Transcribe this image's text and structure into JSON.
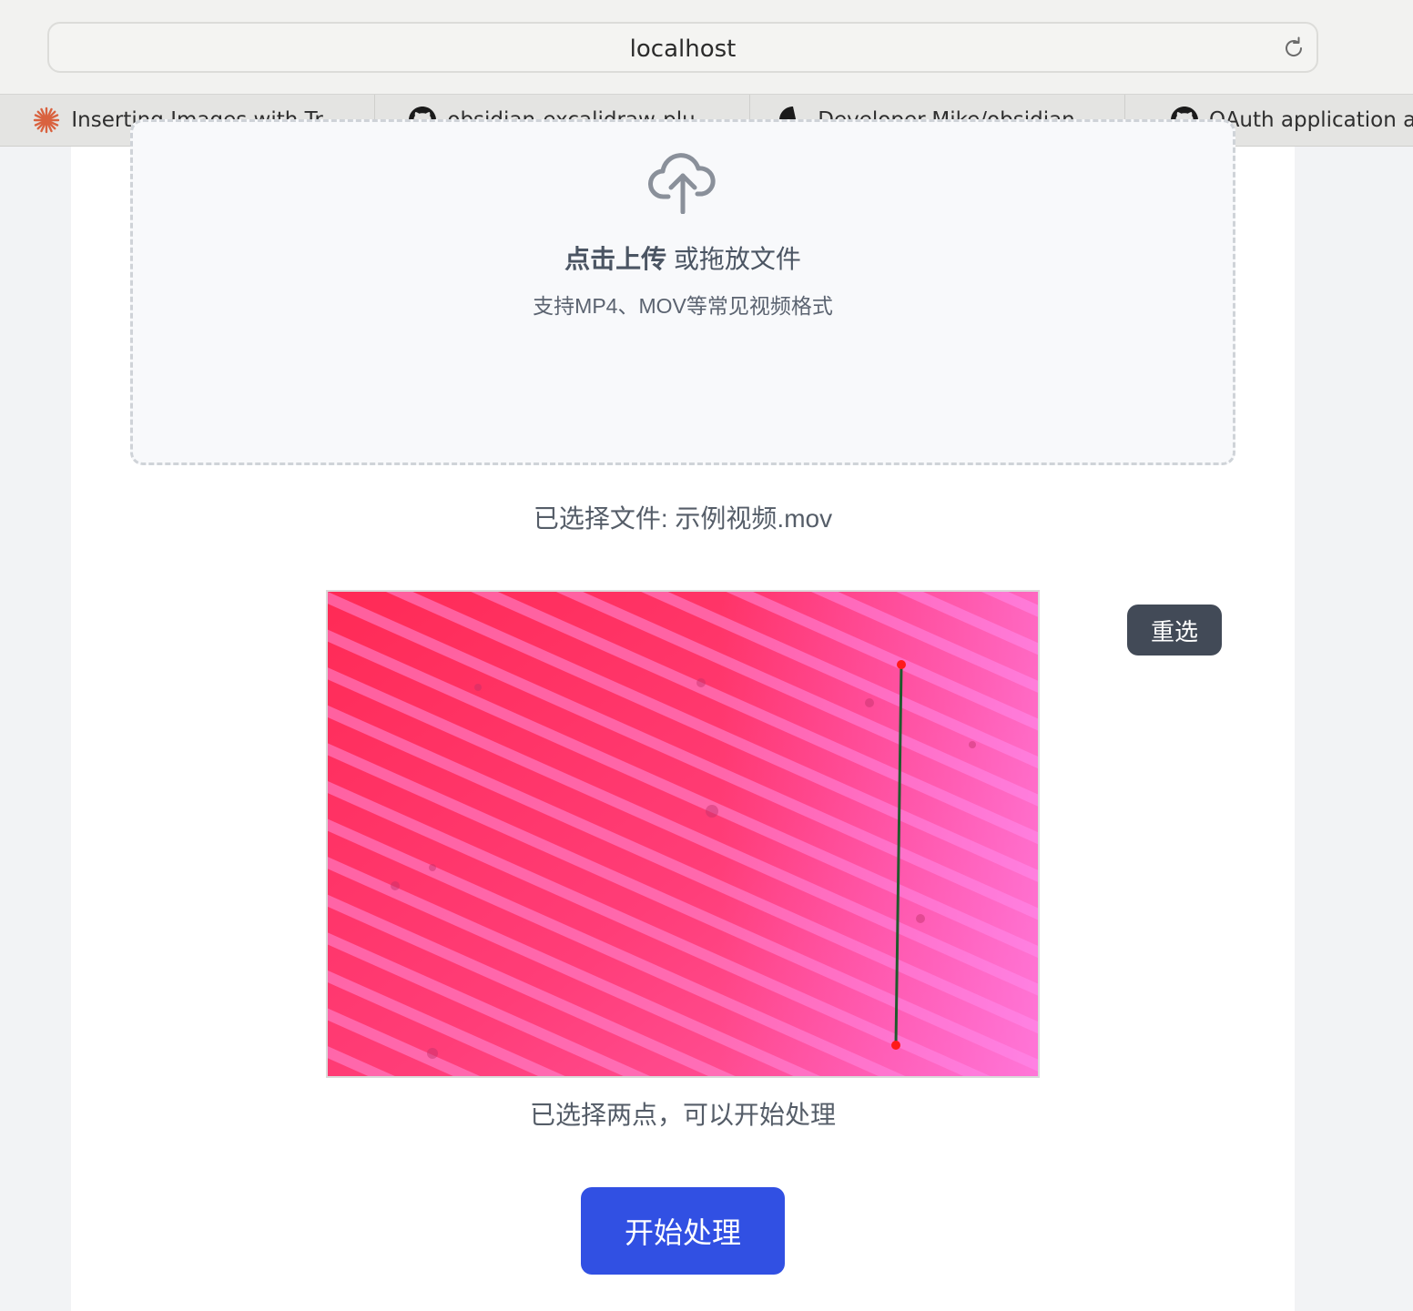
{
  "browser": {
    "url": "localhost",
    "tabs": [
      {
        "label": "Inserting Images with Tr...",
        "icon": "claude-icon"
      },
      {
        "label": "obsidian-excalidraw-plu...",
        "icon": "github-icon"
      },
      {
        "label": "Developer-Mike/obsidian...",
        "icon": "github-icon"
      },
      {
        "label": "OAuth application auth",
        "icon": "github-icon"
      }
    ]
  },
  "upload": {
    "title_bold": "点击上传",
    "title_rest": " 或拖放文件",
    "hint": "支持MP4、MOV等常见视频格式"
  },
  "selected_file": "已选择文件: 示例视频.mov",
  "preview": {
    "reselect_label": "重选",
    "status": "已选择两点，可以开始处理"
  },
  "actions": {
    "start_label": "开始处理"
  },
  "colors": {
    "primary": "#3150e3",
    "secondary_button": "#424a57",
    "marker": "#ff1a1a",
    "line": "#1f5a2c"
  }
}
